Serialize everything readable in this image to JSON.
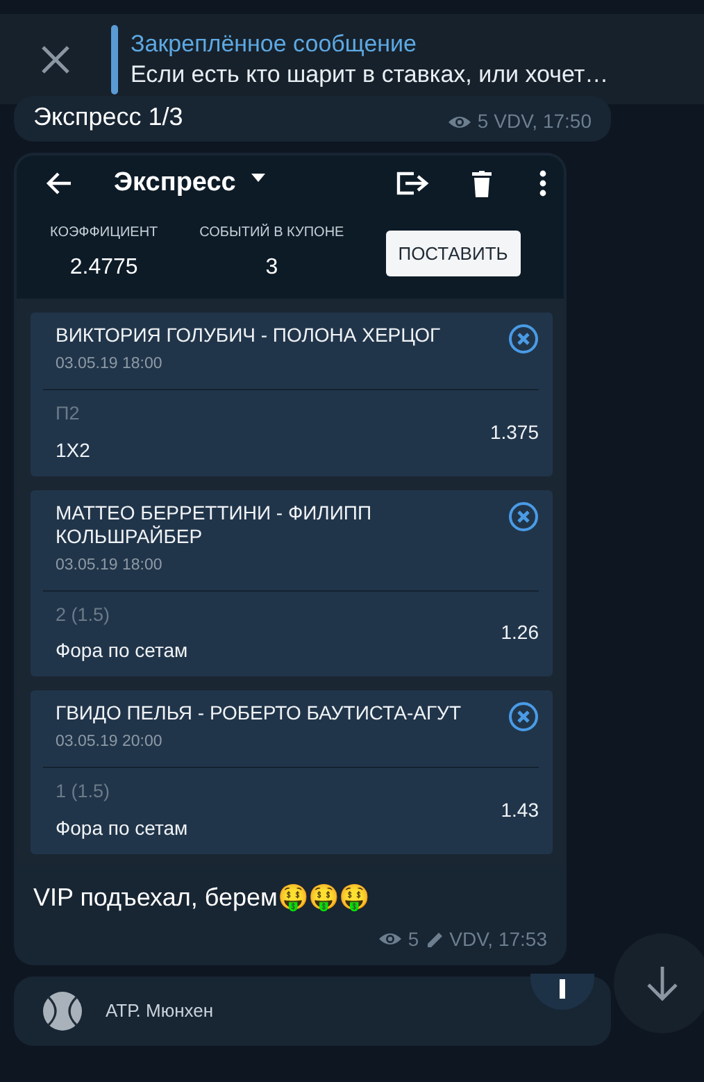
{
  "pinned": {
    "title": "Закреплённое сообщение",
    "text": "Если есть кто шарит в ставках, или хочет…"
  },
  "messages": [
    {
      "kind": "text",
      "text": "Экспресс 1/3",
      "views": "5",
      "edited": false,
      "author_time": "VDV, 17:50"
    },
    {
      "kind": "coupon",
      "screen": {
        "title": "Экспресс",
        "stats": [
          {
            "label": "КОЭФФИЦИЕНТ",
            "value": "2.4775"
          },
          {
            "label": "СОБЫТИЙ В КУПОНЕ",
            "value": "3"
          }
        ],
        "button": "ПОСТАВИТЬ",
        "bets": [
          {
            "match": "ВИКТОРИЯ ГОЛУБИЧ - ПОЛОНА ХЕРЦОГ",
            "date": "03.05.19 18:00",
            "outcome": "П2",
            "market": "1X2",
            "odds": "1.375"
          },
          {
            "match": "МАТТЕО БЕРРЕТТИНИ - ФИЛИПП КОЛЬШРАЙБЕР",
            "date": "03.05.19 18:00",
            "outcome": "2 (1.5)",
            "market": "Фора по сетам",
            "odds": "1.26"
          },
          {
            "match": "ГВИДО ПЕЛЬЯ - РОБЕРТО БАУТИСТА-АГУТ",
            "date": "03.05.19 20:00",
            "outcome": "1 (1.5)",
            "market": "Фора по сетам",
            "odds": "1.43"
          }
        ]
      },
      "text": "VIP подъехал, берем🤑🤑🤑",
      "views": "5",
      "edited": true,
      "author_time": "VDV, 17:53"
    },
    {
      "kind": "preview",
      "text": "АТР. Мюнхен"
    }
  ]
}
